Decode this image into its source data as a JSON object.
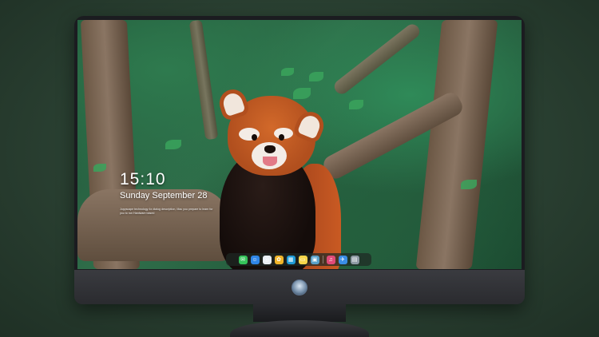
{
  "lockscreen": {
    "time": "15:10",
    "date": "Sunday September 28",
    "note": "Jupyscape technology 4x dialog description, Mac you prepare to learn for you to run Hardware based"
  },
  "dock": {
    "items": [
      {
        "name": "messages",
        "glyph": "✉",
        "color": "#35c35a"
      },
      {
        "name": "finder",
        "glyph": "☺",
        "color": "#2f86e8"
      },
      {
        "name": "safari",
        "glyph": "◎",
        "color": "#e9eef3"
      },
      {
        "name": "photos",
        "glyph": "✿",
        "color": "#f0b429"
      },
      {
        "name": "clapper",
        "glyph": "▦",
        "color": "#1f9ad6"
      },
      {
        "name": "notes",
        "glyph": "▭",
        "color": "#f7d54a"
      },
      {
        "name": "preview",
        "glyph": "▣",
        "color": "#5aa0c8"
      },
      {
        "name": "music",
        "glyph": "♫",
        "color": "#e04a78"
      },
      {
        "name": "mail",
        "glyph": "✈",
        "color": "#3a8ee6"
      },
      {
        "name": "folder",
        "glyph": "▤",
        "color": "#8e9aa4"
      }
    ]
  }
}
